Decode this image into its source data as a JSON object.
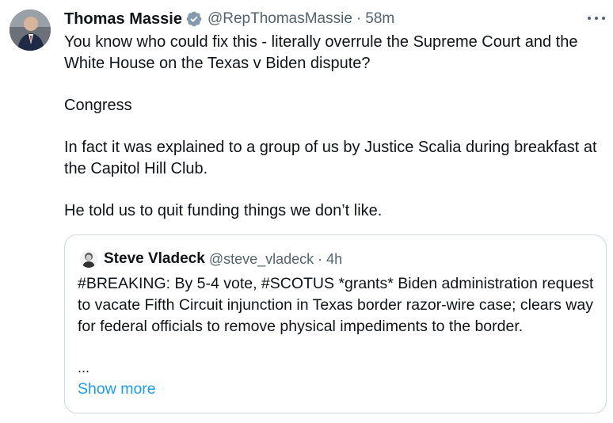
{
  "tweet": {
    "author_name": "Thomas Massie",
    "handle": "@RepThomasMassie",
    "separator": "·",
    "time": "58m",
    "verified_icon": "verified-badge-icon",
    "more_icon": "more-options-icon",
    "paragraphs": [
      "You know who could fix this - literally overrule the Supreme Court and the White House on the Texas v Biden dispute?",
      "Congress",
      "In fact it was explained to a group of us by Justice Scalia during breakfast at the Capitol Hill Club.",
      "He told us to quit funding things we don’t like."
    ]
  },
  "quoted": {
    "author_name": "Steve Vladeck",
    "handle": "@steve_vladeck",
    "separator": "·",
    "time": "4h",
    "text": "#BREAKING: By 5-4 vote, #SCOTUS *grants* Biden administration request to vacate Fifth Circuit injunction in Texas border razor-wire case; clears way for federal officials to remove physical impediments to the border.",
    "ellipsis": "...",
    "show_more": "Show more"
  },
  "colors": {
    "text": "#0f1419",
    "secondary": "#536471",
    "link": "#1d9bf0",
    "verified": "#829aab",
    "border": "#cfd9de"
  }
}
